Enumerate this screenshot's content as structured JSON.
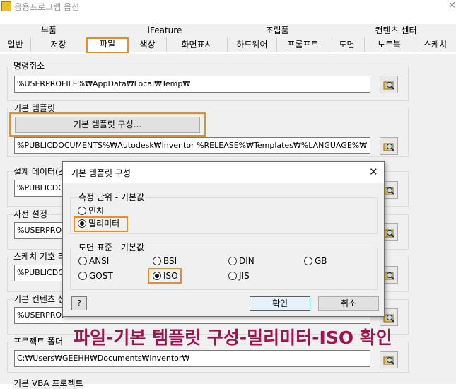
{
  "window": {
    "title": "응용프로그램 옵션",
    "close_glyph": "×"
  },
  "tabs_row1": [
    "부품",
    "iFeature",
    "조립품",
    "컨텐츠 센터"
  ],
  "tabs_row2": [
    "일반",
    "저장",
    "파일",
    "색상",
    "화면표시",
    "하드웨어",
    "프롬프트",
    "도면",
    "노트북",
    "스케치"
  ],
  "active_tab": "파일",
  "groups": {
    "undo": {
      "label": "명령취소",
      "path": "%USERPROFILE%₩AppData₩Local₩Temp₩"
    },
    "template": {
      "label": "기본 템플릿",
      "button_label": "기본 템플릿 구성...",
      "path": "%PUBLICDOCUMENTS%₩Autodesk₩Inventor %RELEASE%₩Templates₩%LANGUAGE%₩"
    },
    "design_data": {
      "label": "설계 데이터(스",
      "path": "%PUBLICDO"
    },
    "dictionary": {
      "label": "사전 설정",
      "path": "%USERPROF"
    },
    "sketch_symbol": {
      "label": "스케치 기호 라",
      "path": "%PUBLICDO"
    },
    "content_center": {
      "label": "기본 컨텐츠 센",
      "path": "%USERPROF"
    },
    "project_folder": {
      "label": "프로젝트 폴더",
      "path": "C:₩Users₩GEEHH₩Documents₩Inventor₩"
    },
    "vba_project": {
      "label": "기본 VBA 프로젝트"
    }
  },
  "dialog": {
    "title": "기본 템플릿 구성",
    "close_glyph": "✕",
    "units": {
      "label": "측정 단위 - 기본값",
      "options": [
        "인치",
        "밀리미터"
      ],
      "selected": "밀리미터"
    },
    "drawing_standard": {
      "label": "도면 표준 - 기본값",
      "options": [
        "ANSI",
        "BSI",
        "DIN",
        "GB",
        "GOST",
        "ISO",
        "JIS"
      ],
      "selected": "ISO"
    },
    "help_label": "?",
    "ok_label": "확인",
    "cancel_label": "취소"
  },
  "caption": "파일-기본 템플릿 구성-밀리미터-ISO 확인",
  "colors": {
    "highlight": "#f08a24",
    "caption": "#a0134e",
    "ok_border": "#0078d7"
  }
}
